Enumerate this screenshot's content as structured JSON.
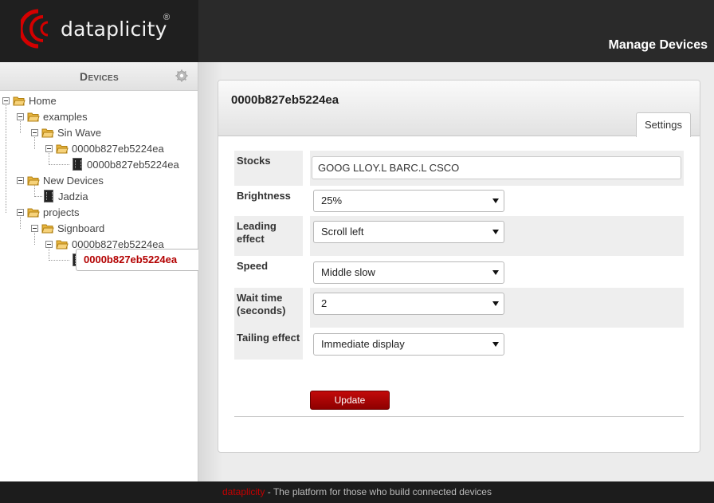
{
  "header": {
    "logo_text": "dataplicity",
    "logo_reg": "®",
    "page_title": "Manage Devices"
  },
  "sidebar": {
    "title": "Devices",
    "settings_icon": "gear-icon",
    "tree": [
      {
        "label": "Home",
        "type": "folder",
        "depth": 0
      },
      {
        "label": "examples",
        "type": "folder",
        "depth": 1
      },
      {
        "label": "Sin Wave",
        "type": "folder",
        "depth": 2
      },
      {
        "label": "0000b827eb5224ea",
        "type": "folder",
        "depth": 3
      },
      {
        "label": "0000b827eb5224ea",
        "type": "device",
        "depth": 4
      },
      {
        "label": "New Devices",
        "type": "folder",
        "depth": 1
      },
      {
        "label": "Jadzia",
        "type": "device",
        "depth": 2
      },
      {
        "label": "projects",
        "type": "folder",
        "depth": 1
      },
      {
        "label": "Signboard",
        "type": "folder",
        "depth": 2
      },
      {
        "label": "0000b827eb5224ea",
        "type": "folder",
        "depth": 3
      },
      {
        "label": "0000b827eb5224ea",
        "type": "device",
        "depth": 4,
        "selected": true
      }
    ]
  },
  "main": {
    "device_title": "0000b827eb5224ea",
    "tabs": [
      {
        "label": "Settings",
        "active": true
      }
    ],
    "form": {
      "stocks": {
        "label": "Stocks",
        "value": "GOOG LLOY.L BARC.L CSCO"
      },
      "brightness": {
        "label": "Brightness",
        "value": "25%"
      },
      "leading_effect": {
        "label": "Leading effect",
        "value": "Scroll left"
      },
      "speed": {
        "label": "Speed",
        "value": "Middle slow"
      },
      "wait_time": {
        "label": "Wait time (seconds)",
        "value": "2"
      },
      "tailing_effect": {
        "label": "Tailing effect",
        "value": "Immediate display"
      }
    },
    "update_label": "Update"
  },
  "footer": {
    "brand": "dataplicity",
    "tagline": " - The platform for those who build connected devices"
  },
  "colors": {
    "brand_red": "#c40000",
    "selected_node": "#b30000",
    "header_bg": "#2a2a2a"
  }
}
